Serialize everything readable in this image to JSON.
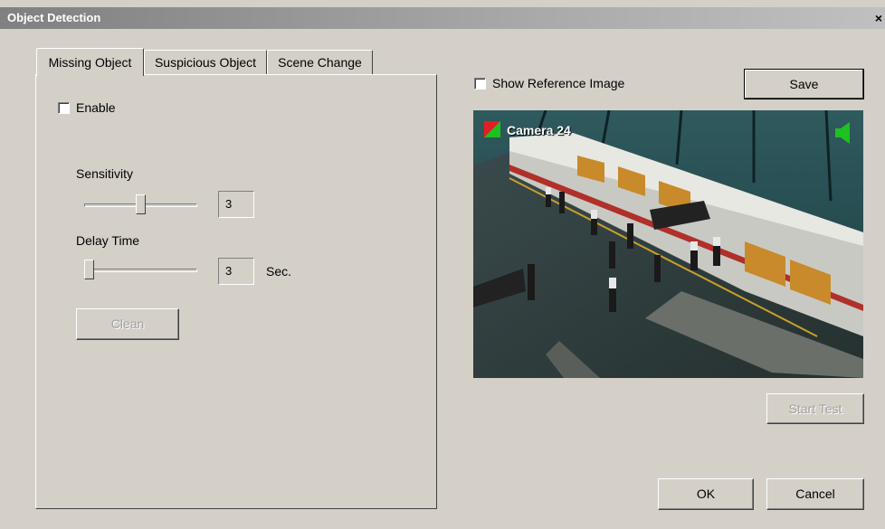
{
  "window": {
    "title": "Object Detection",
    "close_glyph": "×"
  },
  "tabs": [
    {
      "label": "Missing Object",
      "active": true
    },
    {
      "label": "Suspicious Object",
      "active": false
    },
    {
      "label": "Scene Change",
      "active": false
    }
  ],
  "missing_object": {
    "enable_label": "Enable",
    "enable_checked": false,
    "sensitivity": {
      "label": "Sensitivity",
      "value": "3",
      "level_fraction": 0.5
    },
    "delay": {
      "label": "Delay Time",
      "value": "3",
      "unit": "Sec.",
      "level_fraction": 0.0
    },
    "clean_label": "Clean"
  },
  "right_panel": {
    "show_reference_label": "Show Reference Image",
    "show_reference_checked": false,
    "save_label": "Save",
    "camera_label": "Camera 24",
    "start_test_label": "Start Test"
  },
  "footer": {
    "ok_label": "OK",
    "cancel_label": "Cancel"
  },
  "colors": {
    "dialog_bg": "#d4d0c8",
    "title_bar": "#808080",
    "disabled_text": "#a0a0a0",
    "camera_status_red": "#e02020",
    "camera_status_green": "#20c020"
  },
  "icons": [
    "close-icon",
    "camera-status-icon",
    "speaker-icon"
  ]
}
